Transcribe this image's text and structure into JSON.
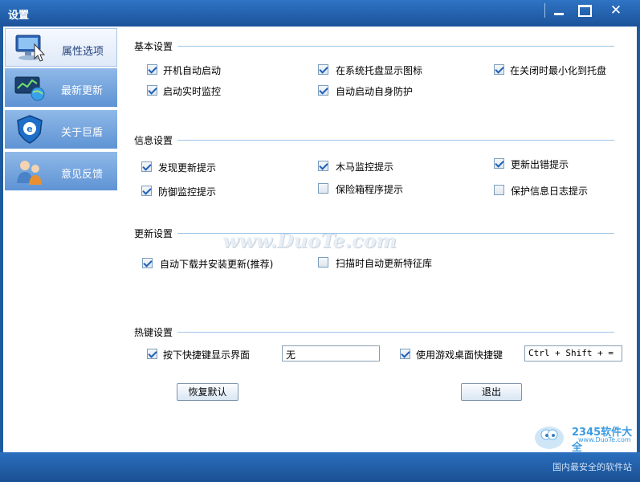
{
  "window": {
    "title": "设置",
    "slogan": "国内最安全的软件站"
  },
  "sidebar": {
    "items": [
      {
        "label": "属性选项",
        "icon": "computer-cursor-icon",
        "active": true
      },
      {
        "label": "最新更新",
        "icon": "update-chart-globe-icon",
        "active": false
      },
      {
        "label": "关于巨盾",
        "icon": "shield-e-icon",
        "active": false
      },
      {
        "label": "意见反馈",
        "icon": "users-feedback-icon",
        "active": false
      }
    ]
  },
  "sections": {
    "basic": {
      "title": "基本设置",
      "items": [
        {
          "label": "开机自动启动",
          "checked": true
        },
        {
          "label": "在系统托盘显示图标",
          "checked": true
        },
        {
          "label": "在关闭时最小化到托盘",
          "checked": true
        },
        {
          "label": "启动实时监控",
          "checked": true
        },
        {
          "label": "自动启动自身防护",
          "checked": true
        }
      ]
    },
    "info": {
      "title": "信息设置",
      "items": [
        {
          "label": "发现更新提示",
          "checked": true
        },
        {
          "label": "木马监控提示",
          "checked": true
        },
        {
          "label": "更新出错提示",
          "checked": true
        },
        {
          "label": "防御监控提示",
          "checked": true
        },
        {
          "label": "保险箱程序提示",
          "checked": false
        },
        {
          "label": "保护信息日志提示",
          "checked": false
        }
      ]
    },
    "update": {
      "title": "更新设置",
      "items": [
        {
          "label": "自动下载并安装更新(推荐)",
          "checked": true
        },
        {
          "label": "扫描时自动更新特征库",
          "checked": false
        }
      ]
    },
    "hotkey": {
      "title": "热键设置",
      "items": [
        {
          "label": "按下快捷键显示界面",
          "checked": true,
          "value": "无"
        },
        {
          "label": "使用游戏桌面快捷键",
          "checked": true,
          "value": "Ctrl + Shift + ="
        }
      ]
    }
  },
  "buttons": {
    "restore": "恢复默认",
    "exit": "退出"
  },
  "watermark": "www.DuoTe.com",
  "logo": {
    "brand": "2345软件大全",
    "url": "www.DuoTe.com"
  },
  "colors": {
    "frame": "#1e5a9e",
    "accent_line": "#9ec6e8",
    "check": "#1f5fb8"
  }
}
